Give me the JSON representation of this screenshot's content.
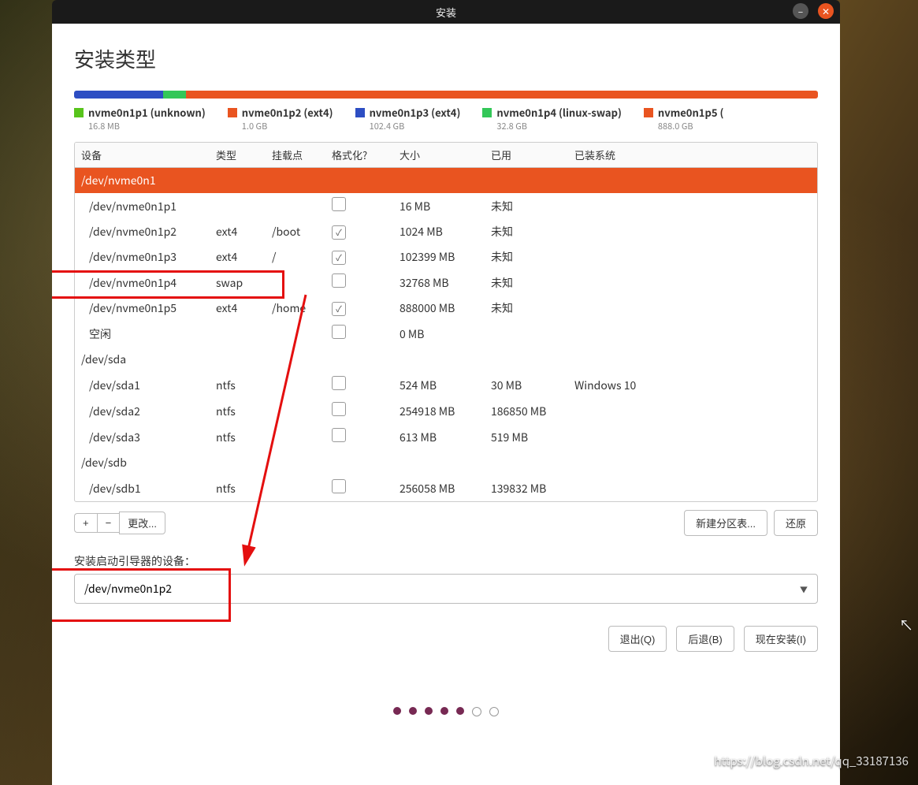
{
  "titlebar": {
    "title": "安装"
  },
  "page": {
    "heading": "安装类型"
  },
  "legend": [
    {
      "color": "#58c41c",
      "label": "nvme0n1p1 (unknown)",
      "sub": "16.8 MB",
      "width": 0.4
    },
    {
      "color": "#e95420",
      "label": "nvme0n1p2 (ext4)",
      "sub": "1.0 GB",
      "width": 0.4
    },
    {
      "color": "#2d4ec3",
      "label": "nvme0n1p3 (ext4)",
      "sub": "102.4 GB",
      "width": 10.8
    },
    {
      "color": "#33c758",
      "label": "nvme0n1p4 (linux-swap)",
      "sub": "32.8 GB",
      "width": 3
    },
    {
      "color": "#e95420",
      "label": "nvme0n1p5 (",
      "sub": "888.0 GB",
      "width": 85.4
    }
  ],
  "columns": {
    "device": "设备",
    "type": "类型",
    "mount": "挂载点",
    "format": "格式化?",
    "size": "大小",
    "used": "已用",
    "system": "已装系统"
  },
  "rows": [
    {
      "kind": "disk",
      "device": "/dev/nvme0n1"
    },
    {
      "kind": "part",
      "device": "/dev/nvme0n1p1",
      "type": "",
      "mount": "",
      "format": false,
      "size": "16 MB",
      "used": "未知",
      "system": ""
    },
    {
      "kind": "part",
      "device": "/dev/nvme0n1p2",
      "type": "ext4",
      "mount": "/boot",
      "format": true,
      "size": "1024 MB",
      "used": "未知",
      "system": ""
    },
    {
      "kind": "part",
      "device": "/dev/nvme0n1p3",
      "type": "ext4",
      "mount": "/",
      "format": true,
      "size": "102399 MB",
      "used": "未知",
      "system": ""
    },
    {
      "kind": "part",
      "device": "/dev/nvme0n1p4",
      "type": "swap",
      "mount": "",
      "format": false,
      "size": "32768 MB",
      "used": "未知",
      "system": ""
    },
    {
      "kind": "part",
      "device": "/dev/nvme0n1p5",
      "type": "ext4",
      "mount": "/home",
      "format": true,
      "size": "888000 MB",
      "used": "未知",
      "system": ""
    },
    {
      "kind": "part",
      "device": "空闲",
      "type": "",
      "mount": "",
      "format": false,
      "size": "0 MB",
      "used": "",
      "system": ""
    },
    {
      "kind": "disk",
      "device": "/dev/sda"
    },
    {
      "kind": "part",
      "device": "/dev/sda1",
      "type": "ntfs",
      "mount": "",
      "format": false,
      "size": "524 MB",
      "used": "30 MB",
      "system": "Windows 10"
    },
    {
      "kind": "part",
      "device": "/dev/sda2",
      "type": "ntfs",
      "mount": "",
      "format": false,
      "size": "254918 MB",
      "used": "186850 MB",
      "system": ""
    },
    {
      "kind": "part",
      "device": "/dev/sda3",
      "type": "ntfs",
      "mount": "",
      "format": false,
      "size": "613 MB",
      "used": "519 MB",
      "system": ""
    },
    {
      "kind": "disk",
      "device": "/dev/sdb"
    },
    {
      "kind": "part",
      "device": "/dev/sdb1",
      "type": "ntfs",
      "mount": "",
      "format": false,
      "size": "256058 MB",
      "used": "139832 MB",
      "system": ""
    }
  ],
  "toolbar": {
    "add": "+",
    "remove": "−",
    "change": "更改...",
    "newtable": "新建分区表...",
    "revert": "还原"
  },
  "boot": {
    "label": "安装启动引导器的设备：",
    "value": "/dev/nvme0n1p2"
  },
  "actions": {
    "quit": "退出(Q)",
    "back": "后退(B)",
    "install": "现在安装(I)"
  },
  "watermark": "https://blog.csdn.net/qq_33187136"
}
